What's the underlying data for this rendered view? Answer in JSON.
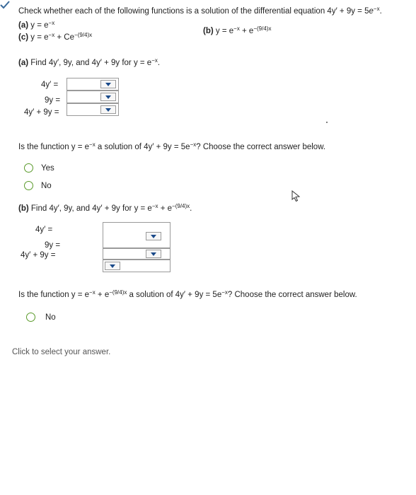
{
  "question": {
    "intro": "Check whether each of the following functions is a solution of the differential equation 4y′ + 9y = 5",
    "intro_e": "e",
    "intro_exp": "−x",
    "intro_end": "."
  },
  "functions": {
    "a_label": "(a)",
    "a_text": "y = e",
    "a_exp": "−x",
    "b_label": "(b)",
    "b_text": "y = e",
    "b_exp1": "−x",
    "b_mid": " + e",
    "b_exp2": "−(9/4)x",
    "c_label": "(c)",
    "c_text": "y = e",
    "c_exp1": "−x",
    "c_mid": " + Ce",
    "c_exp2": "−(9/4)x"
  },
  "part_a": {
    "prompt_label": "(a)",
    "prompt": "Find 4y′, 9y, and 4y′ + 9y for y = e",
    "prompt_exp": "−x",
    "prompt_end": ".",
    "row1_label": "4y′ =",
    "row2_label": "9y =",
    "row3_label": "4y′ + 9y =",
    "question": "Is the function y = e",
    "question_exp1": "−x",
    "question_mid": " a solution of 4y′ + 9y = 5e",
    "question_exp2": "−x",
    "question_end": "? Choose the correct answer below.",
    "option_yes": "Yes",
    "option_no": "No"
  },
  "part_b": {
    "prompt_label": "(b)",
    "prompt": "Find 4y′, 9y, and 4y′ + 9y for y = e",
    "prompt_exp1": "−x",
    "prompt_mid": " + e",
    "prompt_exp2": "−(9/4)x",
    "prompt_end": ".",
    "row1_label": "4y′ =",
    "row2_label": "9y =",
    "row3_label": "4y′ + 9y =",
    "question": "Is the function y = e",
    "question_exp1": "−x",
    "question_mid": " + e",
    "question_exp2": "−(9/4)x",
    "question_mid2": " a solution of 4y′ + 9y = 5e",
    "question_exp3": "−x",
    "question_end": "? Choose the correct answer below.",
    "option_no": "No"
  },
  "footer": {
    "hint": "Click to select your answer."
  },
  "colors": {
    "radio_border": "#5a9a2a",
    "dropdown_arrow": "#1a4a8a"
  },
  "icons": {
    "corner": "check-mark-icon",
    "cursor": "mouse-cursor-icon"
  }
}
